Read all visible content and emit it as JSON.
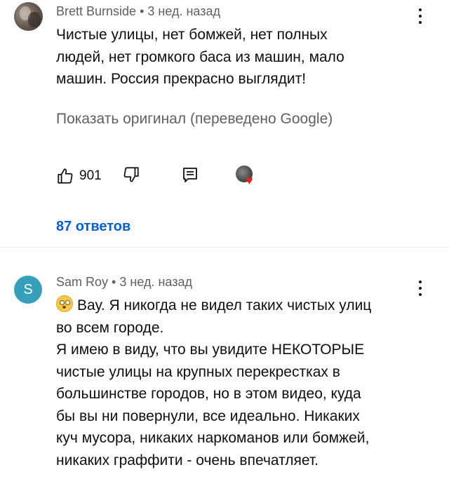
{
  "comment1": {
    "author": "Brett Burnside",
    "separator": "•",
    "time": "3 нед. назад",
    "text_lines": [
      "Чистые улицы, нет бомжей, нет полных",
      "людей, нет громкого баса из машин, мало",
      "машин. Россия прекрасно выглядит!"
    ],
    "show_original": "Показать оригинал (переведено Google)",
    "likes": "901",
    "replies": "87 ответов",
    "icons": [
      "like-icon",
      "dislike-icon",
      "reply-icon",
      "creator-heart-icon",
      "more-vert-icon"
    ],
    "colors": {
      "replies_link": "#065fd4",
      "heart": "#e62117"
    }
  },
  "comment2": {
    "avatar_letter": "S",
    "author": "Sam Roy",
    "separator": "•",
    "time": "3 нед. назад",
    "text_lines": [
      "Вау. Я никогда не видел таких чистых улиц",
      "во всем городе.",
      "Я имею в виду, что вы увидите НЕКОТОРЫЕ",
      "чистые улицы на крупных перекрестках в",
      "большинстве городов, но в этом видео, куда",
      "бы вы ни повернули, все идеально. Никаких",
      "куч мусора, никаких наркоманов или бомжей,",
      "никаких граффити - очень впечатляет."
    ],
    "icons": [
      "flushed-face-emoji-icon",
      "more-vert-icon"
    ],
    "colors": {
      "avatar_bg": "#36a0ba"
    }
  }
}
